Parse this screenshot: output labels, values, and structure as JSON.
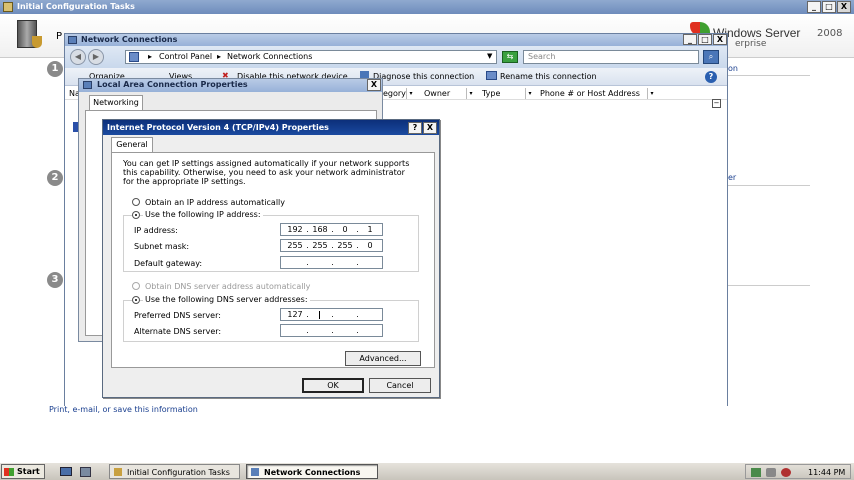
{
  "initial_config": {
    "title": "Initial Configuration Tasks",
    "brand": "Windows Server",
    "brand_version": "2008",
    "brand_edition": "erprise",
    "link_right_1": "on",
    "link_right_2": "er",
    "bottom_link": "Print, e-mail, or save this information",
    "controls": {
      "minimize": "_",
      "maximize": "□",
      "close": "X"
    }
  },
  "network_connections": {
    "title": "Network Connections",
    "breadcrumb": [
      "Control Panel",
      "Network Connections"
    ],
    "breadcrumb_sep": "▸",
    "search_placeholder": "Search",
    "toolbar": {
      "organize": "Organize",
      "views": "Views",
      "disable": "Disable this network device",
      "diagnose": "Diagnose this connection",
      "rename": "Rename this connection"
    },
    "columns": {
      "partial": "Na",
      "category": "egory",
      "owner": "Owner",
      "type": "Type",
      "phone": "Phone # or Host Address"
    },
    "controls": {
      "minimize": "_",
      "maximize": "□",
      "close": "X"
    }
  },
  "lan_properties": {
    "title": "Local Area Connection Properties",
    "tab": "Networking",
    "close": "X"
  },
  "ipv4_dialog": {
    "title": "Internet Protocol Version 4 (TCP/IPv4) Properties",
    "help": "?",
    "close": "X",
    "tab": "General",
    "description": [
      "You can get IP settings assigned automatically if your network supports",
      "this capability. Otherwise, you need to ask your network administrator",
      "for the appropriate IP settings."
    ],
    "obtain_ip_auto": "Obtain an IP address automatically",
    "use_following_ip": "Use the following IP address:",
    "ip_label": "IP address:",
    "ip_value": [
      "192",
      "168",
      "0",
      "1"
    ],
    "mask_label": "Subnet mask:",
    "mask_value": [
      "255",
      "255",
      "255",
      "0"
    ],
    "gateway_label": "Default gateway:",
    "gateway_value": [
      "",
      "",
      "",
      ""
    ],
    "obtain_dns_auto": "Obtain DNS server address automatically",
    "use_following_dns": "Use the following DNS server addresses:",
    "pref_dns_label": "Preferred DNS server:",
    "pref_dns_value": [
      "127",
      "",
      "",
      ""
    ],
    "alt_dns_label": "Alternate DNS server:",
    "alt_dns_value": [
      "",
      "",
      "",
      ""
    ],
    "advanced": "Advanced...",
    "ok": "OK",
    "cancel": "Cancel",
    "dot": "."
  },
  "taskbar": {
    "start": "Start",
    "tasks": [
      "Initial Configuration Tasks",
      "Network Connections"
    ],
    "clock": "11:44 PM"
  },
  "left_numbers": [
    "1",
    "2",
    "3"
  ],
  "colors": {
    "titlebar_active": "#0a246a",
    "titlebar_inactive": "#7a96c2",
    "window_bg": "#ece9d8",
    "desktop_bg": "#ffffff",
    "taskbar_bg": "#d4d0c8"
  }
}
